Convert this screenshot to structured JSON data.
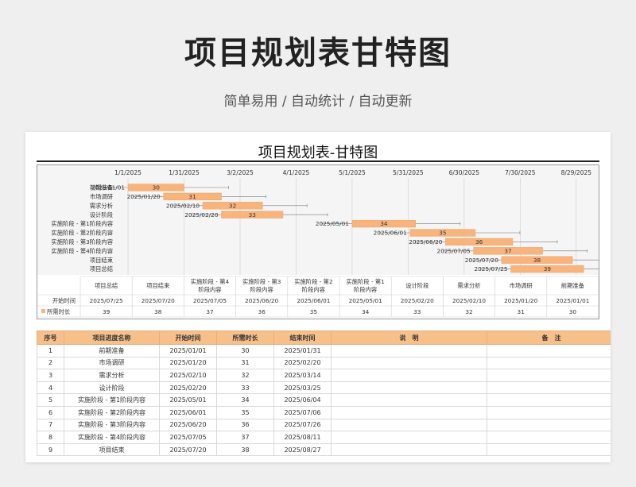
{
  "hero": {
    "title": "项目规划表甘特图",
    "subtitle": "简单易用  /  自动统计  /  自动更新"
  },
  "sheet": {
    "title": "项目规划表-甘特图"
  },
  "colors": {
    "bar": "#f7b47d",
    "bar_stroke": "#f3a261",
    "header": "#f7c08a",
    "grid": "#cfcfcf"
  },
  "chart_data": {
    "type": "bar",
    "orientation": "horizontal-stacked",
    "x_axis_ticks": [
      "1/1/2025",
      "1/31/2025",
      "3/2/2025",
      "4/1/2025",
      "5/1/2025",
      "5/31/2025",
      "6/30/2025",
      "7/30/2025",
      "8/29/2025"
    ],
    "xlim": [
      "2024-12-09",
      "2025-09-10"
    ],
    "categories": [
      "前期准备",
      "市场调研",
      "需求分析",
      "设计阶段",
      "实施阶段 - 第1阶段内容",
      "实施阶段 - 第2阶段内容",
      "实施阶段 - 第3阶段内容",
      "实施阶段 - 第4阶段内容",
      "项目结束",
      "项目总结"
    ],
    "start_labels": [
      "2025/01/01",
      "2025/01/20",
      "2025/02/10",
      "2025/02/20",
      "2025/05/01",
      "2025/06/01",
      "2025/06/20",
      "2025/07/05",
      "2025/07/20",
      "2025/07/25"
    ],
    "starts": [
      "2025-01-01",
      "2025-01-20",
      "2025-02-10",
      "2025-02-20",
      "2025-05-01",
      "2025-06-01",
      "2025-06-20",
      "2025-07-05",
      "2025-07-20",
      "2025-07-25"
    ],
    "durations": [
      30,
      31,
      32,
      33,
      34,
      35,
      36,
      37,
      38,
      39
    ],
    "table_columns": [
      "项目总结",
      "项目结束",
      "实施阶段 - 第4阶段内容",
      "实施阶段 - 第3阶段内容",
      "实施阶段 - 第2阶段内容",
      "实施阶段 - 第1阶段内容",
      "设计阶段",
      "需求分析",
      "市场调研",
      "前期准备"
    ],
    "table_starts": [
      "2025/07/25",
      "2025/07/20",
      "2025/07/05",
      "2025/06/20",
      "2025/06/01",
      "2025/05/01",
      "2025/02/20",
      "2025/02/10",
      "2025/01/20",
      "2025/01/01"
    ],
    "table_durations": [
      "39",
      "38",
      "37",
      "36",
      "35",
      "34",
      "33",
      "32",
      "31",
      "30"
    ],
    "row_label_start": "开始时间",
    "row_label_duration": "所需时长",
    "grid": true,
    "legend": "bottom-left"
  },
  "table": {
    "headers": [
      "序号",
      "项目进度名称",
      "开始时间",
      "所需时长",
      "结束时间",
      "说　明",
      "备　注"
    ],
    "rows": [
      [
        "1",
        "前期准备",
        "2025/01/01",
        "30",
        "2025/01/31",
        "",
        ""
      ],
      [
        "2",
        "市场调研",
        "2025/01/20",
        "31",
        "2025/02/20",
        "",
        ""
      ],
      [
        "3",
        "需求分析",
        "2025/02/10",
        "32",
        "2025/03/14",
        "",
        ""
      ],
      [
        "4",
        "设计阶段",
        "2025/02/20",
        "33",
        "2025/03/25",
        "",
        ""
      ],
      [
        "5",
        "实施阶段 - 第1阶段内容",
        "2025/05/01",
        "34",
        "2025/06/04",
        "",
        ""
      ],
      [
        "6",
        "实施阶段 - 第2阶段内容",
        "2025/06/01",
        "35",
        "2025/07/06",
        "",
        ""
      ],
      [
        "7",
        "实施阶段 - 第3阶段内容",
        "2025/06/20",
        "36",
        "2025/07/26",
        "",
        ""
      ],
      [
        "8",
        "实施阶段 - 第4阶段内容",
        "2025/07/05",
        "37",
        "2025/08/11",
        "",
        ""
      ],
      [
        "9",
        "项目结束",
        "2025/07/20",
        "38",
        "2025/08/27",
        "",
        ""
      ]
    ]
  }
}
